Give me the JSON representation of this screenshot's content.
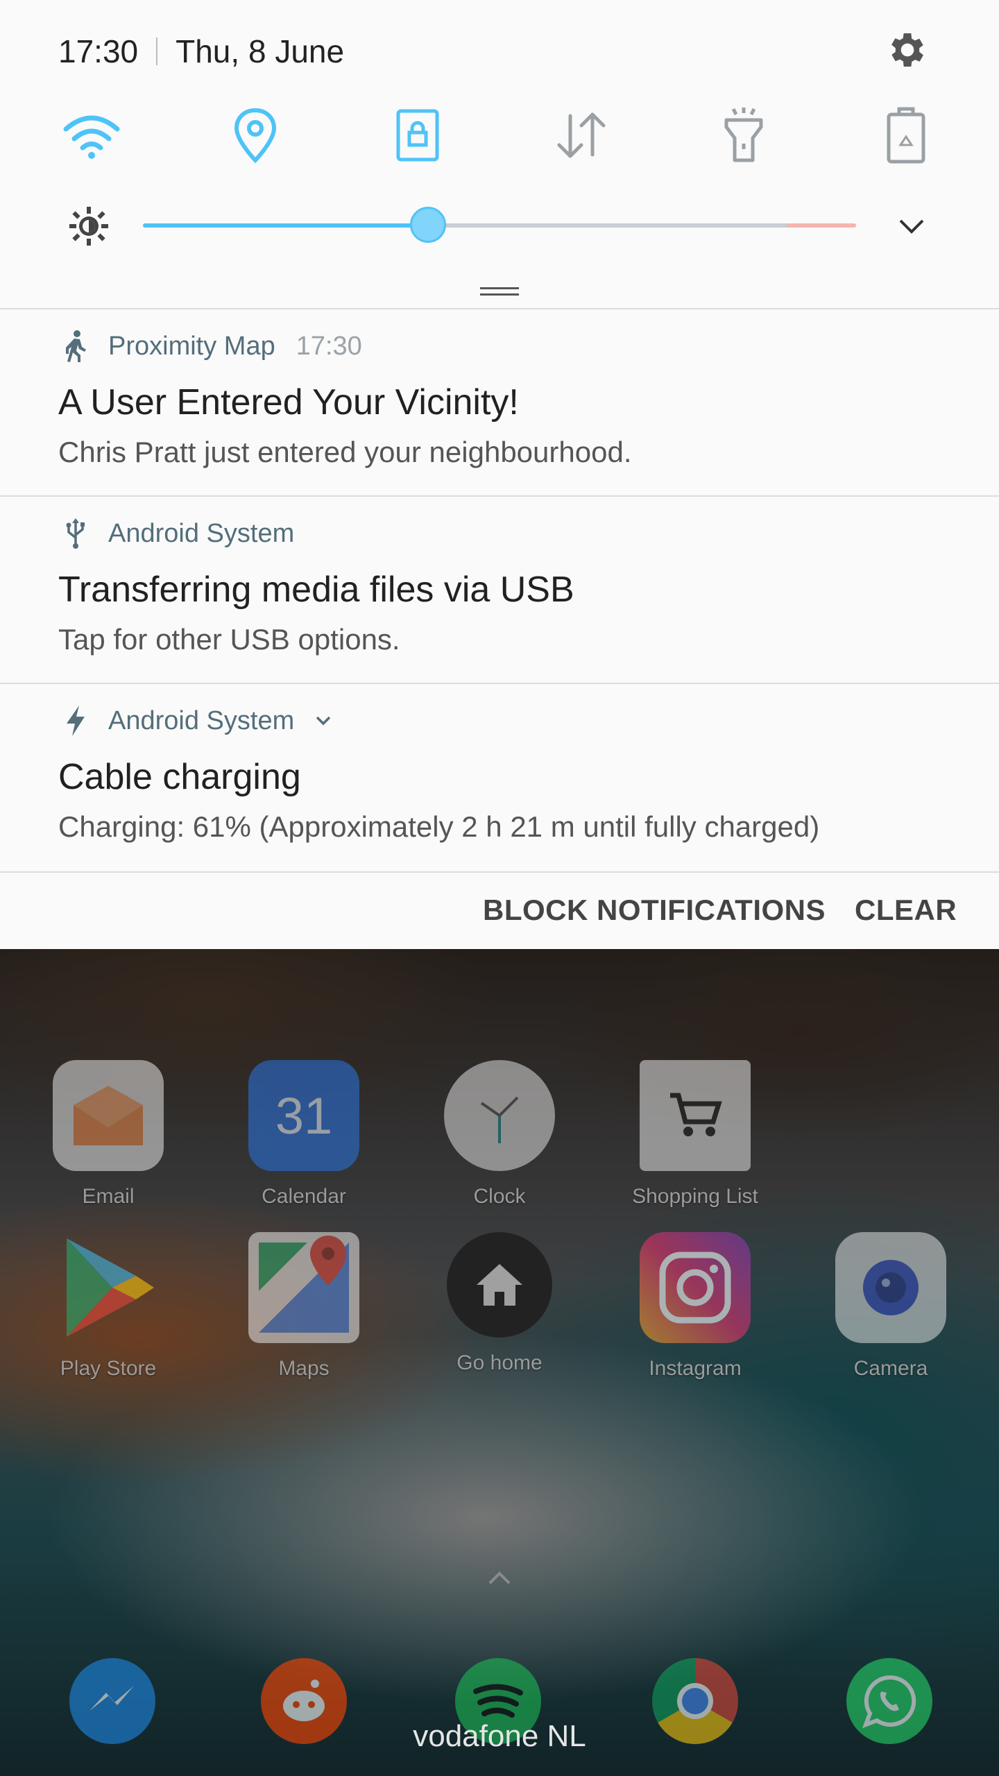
{
  "status": {
    "time": "17:30",
    "date": "Thu, 8 June"
  },
  "quick_settings": [
    {
      "name": "wifi",
      "active": true
    },
    {
      "name": "location",
      "active": true
    },
    {
      "name": "screen-rotation-lock",
      "active": true
    },
    {
      "name": "mobile-data",
      "active": false
    },
    {
      "name": "flashlight",
      "active": false
    },
    {
      "name": "power-saving",
      "active": false
    }
  ],
  "brightness": {
    "level_percent": 40
  },
  "colors": {
    "accent": "#4fc3f7",
    "panel": "#fafafa",
    "app_header": "#546e7a"
  },
  "notifications": [
    {
      "app": "Proximity Map",
      "time": "17:30",
      "icon": "walking-person-icon",
      "title": "A User Entered Your Vicinity!",
      "text": "Chris Pratt just entered your neighbourhood."
    },
    {
      "app": "Android System",
      "time": "",
      "icon": "usb-icon",
      "title": "Transferring media files via USB",
      "text": "Tap for other USB options."
    },
    {
      "app": "Android System",
      "time": "",
      "icon": "lightning-icon",
      "title": "Cable charging",
      "text": "Charging: 61% (Approximately 2 h 21 m until fully charged)"
    }
  ],
  "actions": {
    "block": "BLOCK NOTIFICATIONS",
    "clear": "CLEAR"
  },
  "home_apps": [
    {
      "label": "Email"
    },
    {
      "label": "Calendar",
      "badge": "31"
    },
    {
      "label": "Clock"
    },
    {
      "label": "Shopping List"
    },
    {
      "label": "Play Store"
    },
    {
      "label": "Maps"
    },
    {
      "label": "Go home"
    },
    {
      "label": "Instagram"
    },
    {
      "label": "Camera"
    }
  ],
  "dock": [
    "messenger-icon",
    "reddit-icon",
    "spotify-icon",
    "chrome-icon",
    "whatsapp-icon"
  ],
  "carrier": "vodafone NL"
}
